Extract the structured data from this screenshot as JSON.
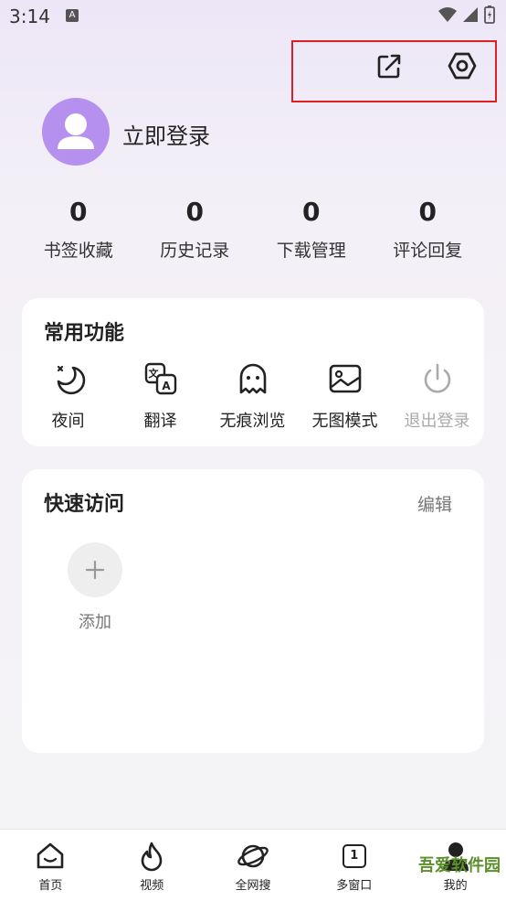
{
  "status": {
    "time": "3:14",
    "a_badge": "A"
  },
  "header": {
    "share_icon": "share-icon",
    "settings_icon": "settings-hex-icon"
  },
  "profile": {
    "login_text": "立即登录"
  },
  "stats": [
    {
      "value": "0",
      "label": "书签收藏"
    },
    {
      "value": "0",
      "label": "历史记录"
    },
    {
      "value": "0",
      "label": "下载管理"
    },
    {
      "value": "0",
      "label": "评论回复"
    }
  ],
  "common": {
    "title": "常用功能",
    "items": [
      {
        "label": "夜间",
        "icon": "moon-icon"
      },
      {
        "label": "翻译",
        "icon": "translate-icon"
      },
      {
        "label": "无痕浏览",
        "icon": "ghost-icon"
      },
      {
        "label": "无图模式",
        "icon": "image-icon"
      },
      {
        "label": "退出登录",
        "icon": "power-icon"
      }
    ]
  },
  "quick": {
    "title": "快速访问",
    "edit": "编辑",
    "add_label": "添加"
  },
  "nav": [
    {
      "label": "首页",
      "icon": "home-icon"
    },
    {
      "label": "视频",
      "icon": "flame-icon"
    },
    {
      "label": "全网搜",
      "icon": "planet-icon"
    },
    {
      "label": "多窗口",
      "icon": "window-count-icon",
      "count": "1"
    },
    {
      "label": "我的",
      "icon": "person-icon"
    }
  ],
  "watermark": "吾爱软件园",
  "colors": {
    "accent_avatar": "#b690ee",
    "highlight_box": "#e02020"
  }
}
